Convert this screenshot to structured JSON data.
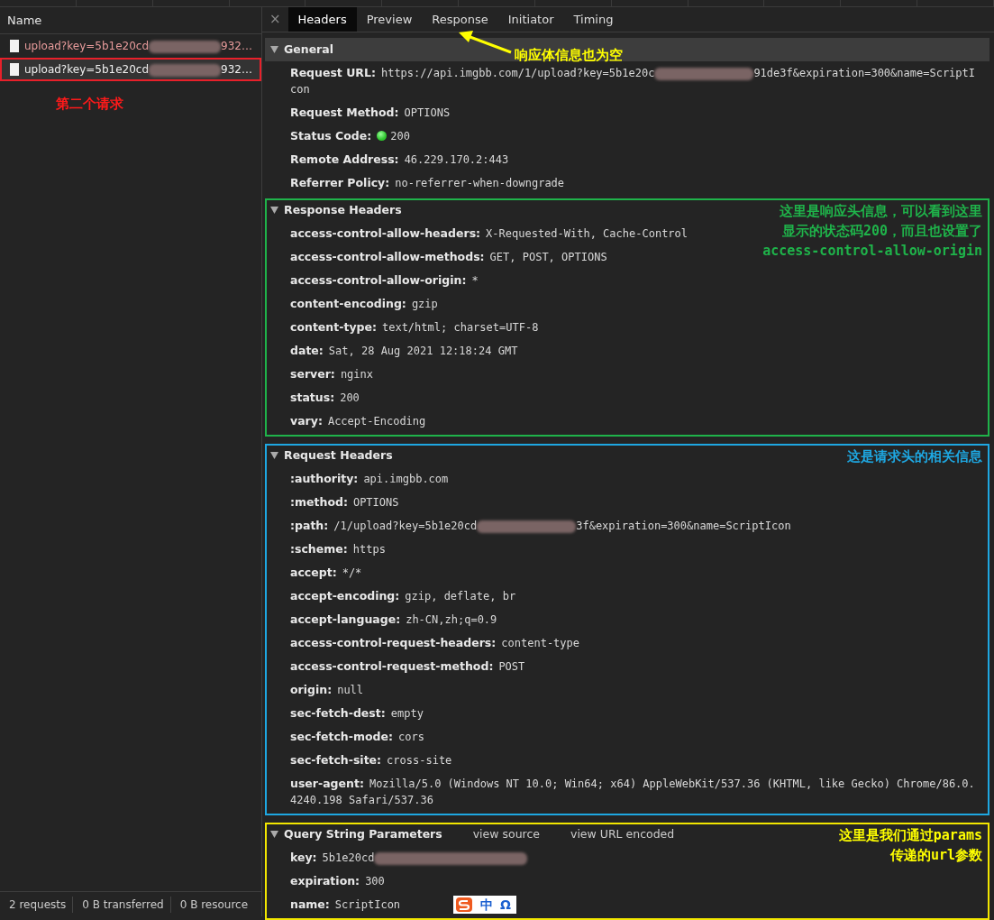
{
  "requests_panel": {
    "column_header": "Name",
    "requests": [
      {
        "name": "upload?key=5b1e20cd",
        "name_after": "932…",
        "failed": true,
        "selected": false
      },
      {
        "name": "upload?key=5b1e20cd",
        "name_after": "932…",
        "failed": false,
        "selected": true,
        "color": "#e8202a"
      }
    ],
    "annotation": {
      "lines": [
        "第二个请求"
      ],
      "color": "#ff1a1a"
    }
  },
  "status_bar": [
    "2 requests",
    "0 B transferred",
    "0 B resource"
  ],
  "tabs": [
    {
      "label": "Headers",
      "selected": true
    },
    {
      "label": "Preview",
      "selected": false
    },
    {
      "label": "Response",
      "selected": false
    },
    {
      "label": "Initiator",
      "selected": false
    },
    {
      "label": "Timing",
      "selected": false
    }
  ],
  "close_label": "×",
  "tab_annotation": {
    "lines": [
      "响应体信息也为空"
    ],
    "color": "#ffff00"
  },
  "sections": [
    {
      "title": "General",
      "expanded": true,
      "shaded": true,
      "rows": [
        {
          "kind": "redacted",
          "name": "Request URL:",
          "value": "https://api.imgbb.com/1/upload?key=5b1e20c",
          "value_after": "91de3f&expiration=300&name=ScriptIcon"
        },
        {
          "kind": "plain",
          "name": "Request Method:",
          "value": "OPTIONS"
        },
        {
          "kind": "status",
          "name": "Status Code:",
          "value": "200",
          "color": "#2ec52e"
        },
        {
          "kind": "plain",
          "name": "Remote Address:",
          "value": "46.229.170.2:443"
        },
        {
          "kind": "plain",
          "name": "Referrer Policy:",
          "value": "no-referrer-when-downgrade"
        }
      ]
    },
    {
      "title": "Response Headers",
      "expanded": true,
      "shaded": false,
      "color": "#1fb34a",
      "annotation": {
        "lines": [
          "这里是响应头信息，可以看到这里",
          "显示的状态码200，而且也设置了",
          "access-control-allow-origin"
        ],
        "color": "#1fb34a"
      },
      "rows": [
        {
          "kind": "plain",
          "name": "access-control-allow-headers:",
          "value": "X-Requested-With, Cache-Control"
        },
        {
          "kind": "plain",
          "name": "access-control-allow-methods:",
          "value": "GET, POST, OPTIONS"
        },
        {
          "kind": "plain",
          "name": "access-control-allow-origin:",
          "value": "*"
        },
        {
          "kind": "plain",
          "name": "content-encoding:",
          "value": "gzip"
        },
        {
          "kind": "plain",
          "name": "content-type:",
          "value": "text/html; charset=UTF-8"
        },
        {
          "kind": "plain",
          "name": "date:",
          "value": "Sat, 28 Aug 2021 12:18:24 GMT"
        },
        {
          "kind": "plain",
          "name": "server:",
          "value": "nginx"
        },
        {
          "kind": "plain",
          "name": "status:",
          "value": "200"
        },
        {
          "kind": "plain",
          "name": "vary:",
          "value": "Accept-Encoding"
        }
      ]
    },
    {
      "title": "Request Headers",
      "expanded": true,
      "shaded": false,
      "color": "#1ea7e1",
      "annotation": {
        "lines": [
          "这是请求头的相关信息"
        ],
        "color": "#1ea7e1"
      },
      "rows": [
        {
          "kind": "plain",
          "name": ":authority:",
          "value": "api.imgbb.com"
        },
        {
          "kind": "plain",
          "name": ":method:",
          "value": "OPTIONS"
        },
        {
          "kind": "redacted",
          "name": ":path:",
          "value": "/1/upload?key=5b1e20cd",
          "value_after": "3f&expiration=300&name=ScriptIcon"
        },
        {
          "kind": "plain",
          "name": ":scheme:",
          "value": "https"
        },
        {
          "kind": "plain",
          "name": "accept:",
          "value": "*/*"
        },
        {
          "kind": "plain",
          "name": "accept-encoding:",
          "value": "gzip, deflate, br"
        },
        {
          "kind": "plain",
          "name": "accept-language:",
          "value": "zh-CN,zh;q=0.9"
        },
        {
          "kind": "plain",
          "name": "access-control-request-headers:",
          "value": "content-type"
        },
        {
          "kind": "plain",
          "name": "access-control-request-method:",
          "value": "POST"
        },
        {
          "kind": "plain",
          "name": "origin:",
          "value": "null"
        },
        {
          "kind": "plain",
          "name": "sec-fetch-dest:",
          "value": "empty"
        },
        {
          "kind": "plain",
          "name": "sec-fetch-mode:",
          "value": "cors"
        },
        {
          "kind": "plain",
          "name": "sec-fetch-site:",
          "value": "cross-site"
        },
        {
          "kind": "plain",
          "name": "user-agent:",
          "value": "Mozilla/5.0 (Windows NT 10.0; Win64; x64) AppleWebKit/537.36 (KHTML, like Gecko) Chrome/86.0.4240.198 Safari/537.36"
        }
      ]
    },
    {
      "title": "Query String Parameters",
      "expanded": true,
      "shaded": false,
      "color": "#f2e600",
      "links": [
        "view source",
        "view URL encoded"
      ],
      "annotation": {
        "lines": [
          "这里是我们通过params",
          "传递的url参数"
        ],
        "color": "#ffff00"
      },
      "rows": [
        {
          "kind": "redacted",
          "name": "key:",
          "value": "5b1e20cd"
        },
        {
          "kind": "plain",
          "name": "expiration:",
          "value": "300"
        },
        {
          "kind": "plain",
          "name": "name:",
          "value": "ScriptIcon"
        }
      ]
    }
  ],
  "ime_toolbar": {
    "labels": [
      "中",
      "Ω"
    ]
  }
}
